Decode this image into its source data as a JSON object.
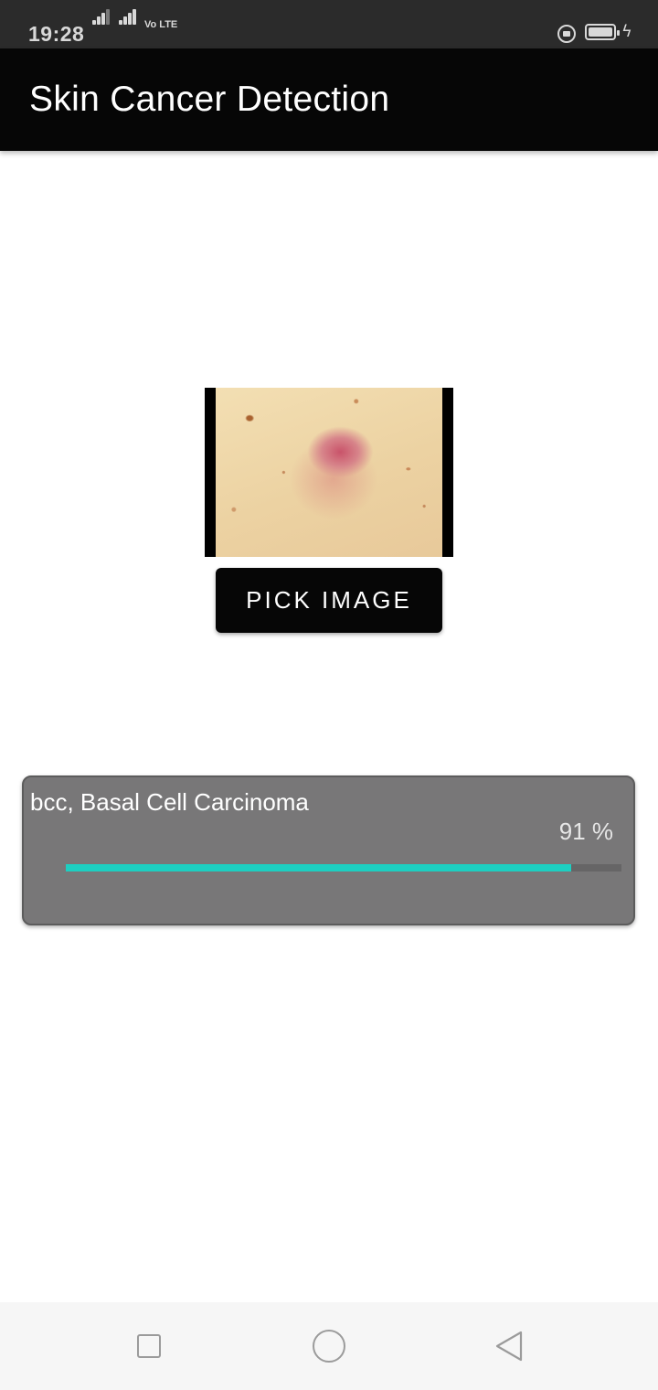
{
  "status_bar": {
    "time": "19:28",
    "network_label": "Vo LTE",
    "icons": [
      "signal-icon",
      "signal-icon",
      "volte-icon",
      "rotation-lock-icon",
      "battery-icon",
      "charging-icon"
    ]
  },
  "app_bar": {
    "title": "Skin Cancer Detection"
  },
  "main": {
    "preview_image": "skin-lesion-photo",
    "pick_button_label": "PICK IMAGE"
  },
  "result": {
    "label": "bcc, Basal Cell Carcinoma",
    "percent_text": "91 %",
    "confidence": 0.91,
    "colors": {
      "card": "#787778",
      "bar": "#1dcfc1",
      "track": "#666566"
    }
  },
  "nav_bar": {
    "buttons": [
      "recents-icon",
      "home-icon",
      "back-icon"
    ]
  }
}
